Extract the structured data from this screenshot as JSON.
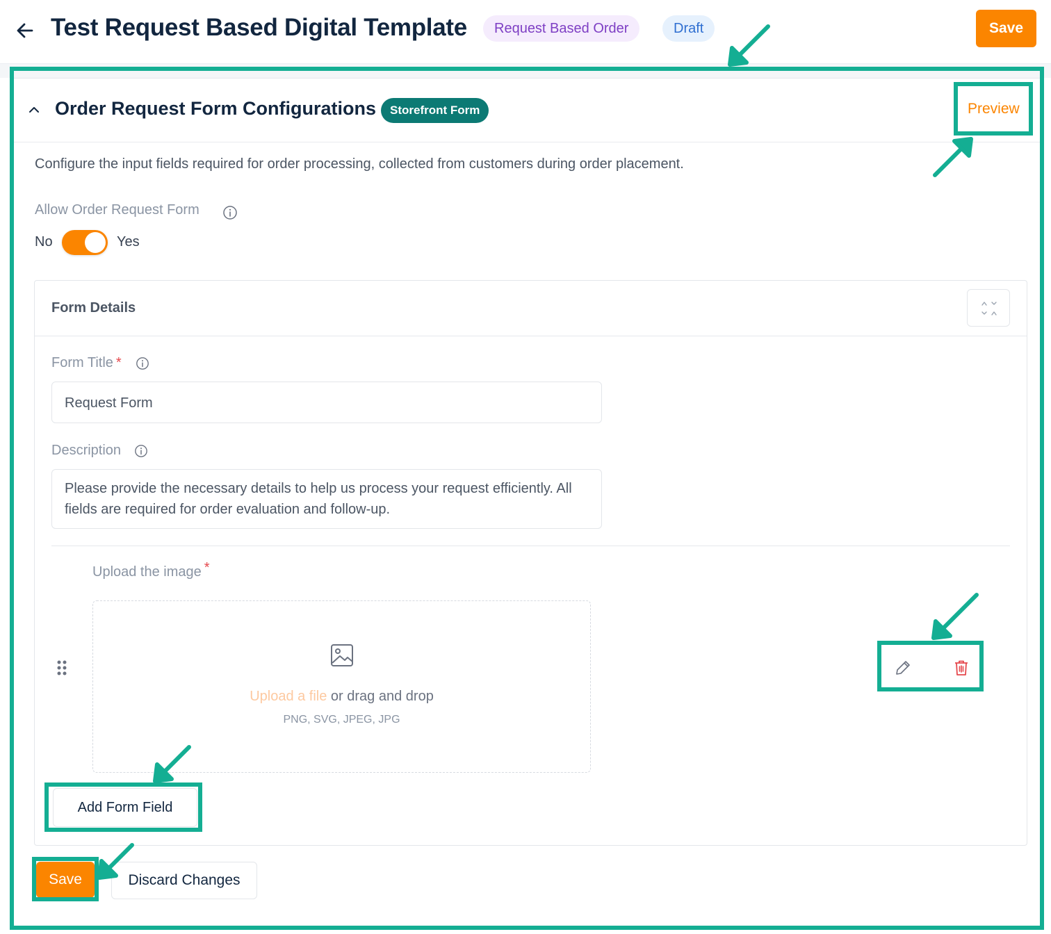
{
  "header": {
    "title": "Test Request Based Digital Template",
    "order_type_badge": "Request Based Order",
    "status_badge": "Draft",
    "save_label": "Save"
  },
  "section": {
    "title": "Order Request Form Configurations",
    "badge": "Storefront Form",
    "preview_label": "Preview",
    "description": "Configure the input fields required for order processing, collected from customers during order placement.",
    "allow_label": "Allow Order Request Form",
    "toggle": {
      "off_label": "No",
      "on_label": "Yes",
      "value": true
    }
  },
  "form_details": {
    "title": "Form Details",
    "form_title_label": "Form Title",
    "form_title_value": "Request Form",
    "required_marker": "*",
    "description_label": "Description",
    "description_value": "Please provide the necessary details to help us process your request efficiently. All fields are required for order evaluation and follow-up.",
    "upload_field": {
      "label": "Upload the image",
      "link_text": "Upload a file",
      "rest_text": " or drag and drop",
      "file_types": "PNG, SVG, JPEG, JPG"
    },
    "add_field_label": "Add Form Field"
  },
  "footer": {
    "save_label": "Save",
    "discard_label": "Discard Changes"
  },
  "colors": {
    "accent": "#fb8500",
    "teal_badge": "#0c7a74",
    "annotation": "#14ae93",
    "danger": "#e5484d"
  },
  "icons": [
    "arrow-left-icon",
    "chevron-up-icon",
    "info-icon",
    "expand-icon",
    "image-icon",
    "drag-handle-icon",
    "pencil-icon",
    "trash-icon"
  ]
}
